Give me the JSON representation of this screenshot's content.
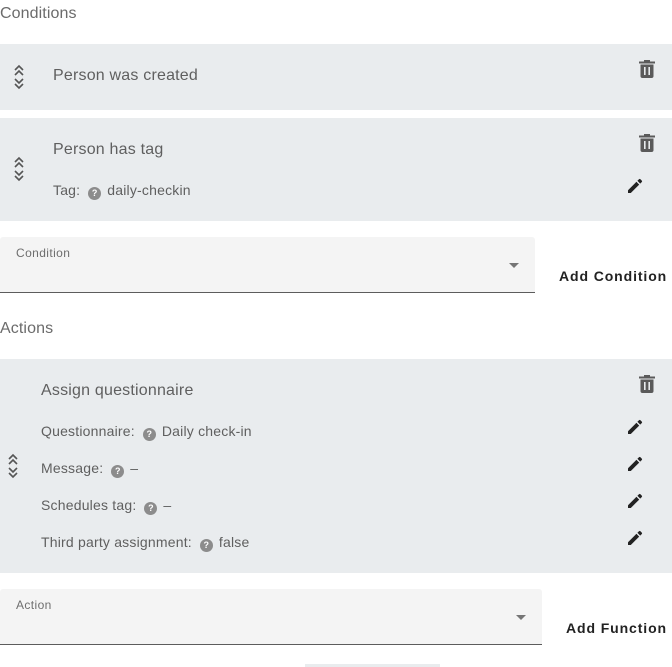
{
  "conditions": {
    "title": "Conditions",
    "items": [
      {
        "title": "Person was created"
      },
      {
        "title": "Person has tag",
        "fields": [
          {
            "label": "Tag:",
            "value": "daily-checkin"
          }
        ]
      }
    ],
    "select_label": "Condition",
    "add_button": "Add Condition"
  },
  "actions": {
    "title": "Actions",
    "item": {
      "title": "Assign questionnaire",
      "fields": [
        {
          "label": "Questionnaire:",
          "value": "Daily check-in"
        },
        {
          "label": "Message:",
          "value": "–"
        },
        {
          "label": "Schedules tag:",
          "value": "–"
        },
        {
          "label": "Third party assignment:",
          "value": "false"
        }
      ]
    },
    "select_label": "Action",
    "add_button": "Add Function"
  },
  "help_glyph": "?",
  "colors": {
    "card_bg": "#e9ecee",
    "select_bg": "#f4f4f4",
    "help_circle": "#8c8c8c"
  }
}
